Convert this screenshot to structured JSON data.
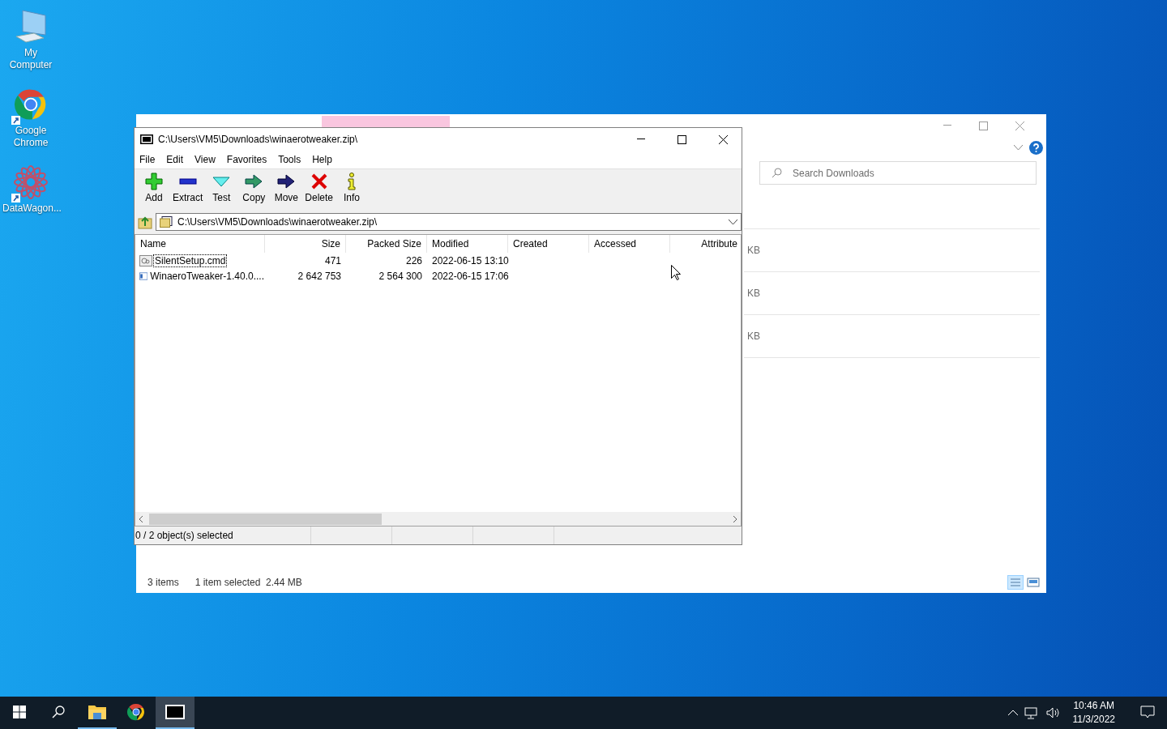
{
  "desktop": {
    "icons": [
      {
        "kind": "computer",
        "label": "My Computer"
      },
      {
        "kind": "chrome",
        "label": "Google Chrome",
        "shortcut": true
      },
      {
        "kind": "wagon",
        "label": "DataWagon...",
        "shortcut": true
      }
    ]
  },
  "explorer": {
    "search": {
      "placeholder": "Search Downloads"
    },
    "sizes": [
      "KB",
      "KB",
      "KB"
    ],
    "status": {
      "count": "3 items",
      "selection": "1 item selected  2.44 MB"
    }
  },
  "sevenzip": {
    "title": "C:\\Users\\VM5\\Downloads\\winaerotweaker.zip\\",
    "menu": [
      "File",
      "Edit",
      "View",
      "Favorites",
      "Tools",
      "Help"
    ],
    "toolbar": [
      {
        "kind": "add",
        "label": "Add"
      },
      {
        "kind": "extract",
        "label": "Extract"
      },
      {
        "kind": "test",
        "label": "Test"
      },
      {
        "kind": "copy",
        "label": "Copy"
      },
      {
        "kind": "move",
        "label": "Move"
      },
      {
        "kind": "delete",
        "label": "Delete"
      },
      {
        "kind": "info",
        "label": "Info"
      }
    ],
    "address": "C:\\Users\\VM5\\Downloads\\winaerotweaker.zip\\",
    "columns": [
      "Name",
      "Size",
      "Packed Size",
      "Modified",
      "Created",
      "Accessed",
      "Attribute"
    ],
    "rows": [
      {
        "kind": "script",
        "focused": true,
        "name": "SilentSetup.cmd",
        "size": "471",
        "packed": "226",
        "modified": "2022-06-15 13:10"
      },
      {
        "kind": "exe",
        "focused": false,
        "name": "WinaeroTweaker-1.40.0....",
        "size": "2 642 753",
        "packed": "2 564 300",
        "modified": "2022-06-15 17:06"
      }
    ],
    "status": "0 / 2 object(s) selected"
  },
  "taskbar": {
    "apps": [
      {
        "kind": "explorer",
        "running": true,
        "active": false
      },
      {
        "kind": "chrome",
        "running": false,
        "active": false
      },
      {
        "kind": "sevenzip",
        "running": true,
        "active": true
      }
    ],
    "time": "10:46 AM",
    "date": "11/3/2022"
  }
}
